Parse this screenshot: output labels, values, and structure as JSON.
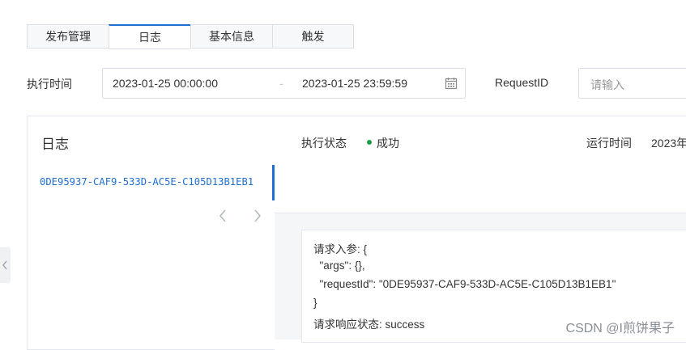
{
  "tabs": [
    {
      "label": "发布管理",
      "active": false
    },
    {
      "label": "日志",
      "active": true
    },
    {
      "label": "基本信息",
      "active": false
    },
    {
      "label": "触发",
      "active": false
    }
  ],
  "filter": {
    "exec_time_label": "执行时间",
    "start_date": "2023-01-25 00:00:00",
    "separator": "-",
    "end_date": "2023-01-25 23:59:59",
    "request_id_label": "RequestID",
    "request_id_placeholder": "请输入"
  },
  "log_panel": {
    "title": "日志",
    "items": [
      "0DE95937-CAF9-533D-AC5E-C105D13B1EB1"
    ]
  },
  "detail": {
    "exec_status_label": "执行状态",
    "exec_status_value": "成功",
    "status_color": "#1f9d46",
    "run_time_label": "运行时间",
    "run_time_value": "2023年",
    "code_lines": [
      "请求入参: {",
      "  \"args\": {},",
      "  \"requestId\": \"0DE95937-CAF9-533D-AC5E-C105D13B1EB1\"",
      "}",
      "请求响应状态: success"
    ]
  },
  "watermark": "CSDN @I煎饼果子",
  "accent_color": "#1f6fd1"
}
